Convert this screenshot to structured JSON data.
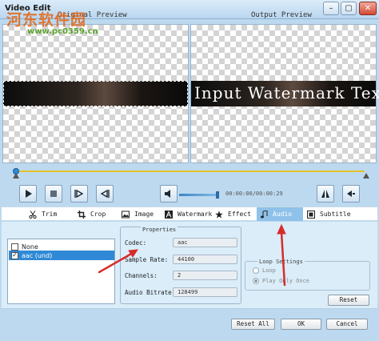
{
  "window": {
    "title": "Video Edit"
  },
  "watermark_site": {
    "logo_text": "河东软件园",
    "url": "www.pc0359.cn"
  },
  "previews": {
    "original_label": "Original Preview",
    "output_label": "Output Preview",
    "watermark_text": "Input Watermark Text"
  },
  "timeline": {
    "position_fraction": 0.0
  },
  "playback": {
    "volume_fraction": 1.0,
    "timecode": "00:00:00/00:00:29"
  },
  "tabs": [
    {
      "label": "Trim",
      "icon": "scissors-icon"
    },
    {
      "label": "Crop",
      "icon": "crop-icon"
    },
    {
      "label": "Image",
      "icon": "image-icon"
    },
    {
      "label": "Watermark",
      "icon": "watermark-icon"
    },
    {
      "label": "Effect",
      "icon": "star-icon"
    },
    {
      "label": "Audio",
      "icon": "music-note-icon",
      "active": true
    },
    {
      "label": "Subtitle",
      "icon": "subtitle-icon"
    }
  ],
  "audio_tracks": [
    {
      "label": "None",
      "checked": false,
      "selected": false
    },
    {
      "label": "aac (und)",
      "checked": true,
      "selected": true
    }
  ],
  "properties": {
    "legend": "Properties",
    "codec_label": "Codec:",
    "codec_value": "aac",
    "sample_rate_label": "Sample Rate:",
    "sample_rate_value": "44100",
    "channels_label": "Channels:",
    "channels_value": "2",
    "bitrate_label": "Audio Bitrate:",
    "bitrate_value": "128499"
  },
  "loop": {
    "legend": "Loop Settings",
    "option_loop": "Loop",
    "option_once": "Play Only Once",
    "selected": "Play Only Once"
  },
  "buttons": {
    "reset": "Reset",
    "reset_all": "Reset All",
    "ok": "OK",
    "cancel": "Cancel"
  },
  "colors": {
    "accent": "#2f89d6",
    "active_tab": "#8fc2ea",
    "timeline": "#e6c12a",
    "annotation_arrow": "#d92b2b"
  }
}
